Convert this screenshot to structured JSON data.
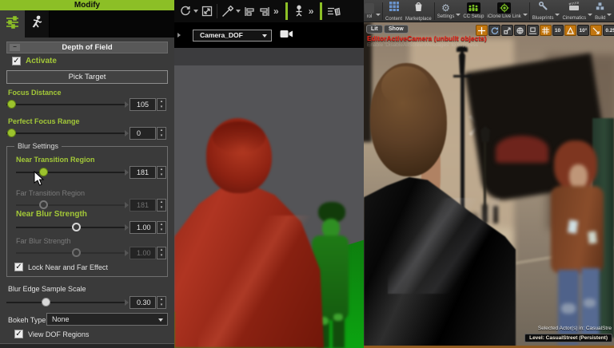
{
  "colors": {
    "accent_green": "#8cbf26",
    "ue_orange": "#c2760f",
    "warning_red": "#e8281c",
    "dof_near_red": "#a62c18",
    "dof_focus_green": "#0ba411"
  },
  "left_panel": {
    "title": "Modify",
    "section_header": "Depth of Field",
    "collapse_glyph": "−",
    "check_glyph": "✓",
    "activate_label": "Activate",
    "pick_target_label": "Pick Target",
    "focus_distance": {
      "label": "Focus Distance",
      "value": "105"
    },
    "perfect_focus_range": {
      "label": "Perfect Focus Range",
      "value": "0"
    },
    "blur_settings_label": "Blur Settings",
    "near_transition": {
      "label": "Near Transition Region",
      "value": "181"
    },
    "far_transition": {
      "label": "Far Transition Region",
      "value": "181"
    },
    "near_blur": {
      "label": "Near Blur Strength",
      "value": "1.00"
    },
    "far_blur": {
      "label": "Far Blur Strength",
      "value": "1.00"
    },
    "lock_label": "Lock Near and Far Effect",
    "blur_edge": {
      "label": "Blur Edge Sample Scale",
      "value": "0.30"
    },
    "bokeh_label": "Bokeh Type :",
    "bokeh_value": "None",
    "view_dof_label": "View DOF Regions",
    "spin_up": "▴",
    "spin_down": "▾"
  },
  "middle": {
    "camera_dropdown": "Camera_DOF",
    "chevron": "»"
  },
  "ue": {
    "toolbar": [
      {
        "label": "rol"
      },
      {
        "label": "Content"
      },
      {
        "label": "Marketplace"
      },
      {
        "label": "Settings"
      },
      {
        "label": "CC Setup"
      },
      {
        "label": "iClone Live Link"
      },
      {
        "label": "Blueprints"
      },
      {
        "label": "Cinematics"
      },
      {
        "label": "Build"
      }
    ],
    "viewport": {
      "lit": "Lit",
      "show": "Show",
      "warning": "EditorActiveCamera (unbuilt objects)",
      "warning_sub": "Enable 'DisableAllScreenMessages' to suppress",
      "snap_grid": "10",
      "snap_angle": "10°",
      "snap_scale": "0.25",
      "selected_actors": "Selected Actor(s) in:  CasualStre",
      "level": "Level:  CasualStreet (Persistent)"
    }
  }
}
